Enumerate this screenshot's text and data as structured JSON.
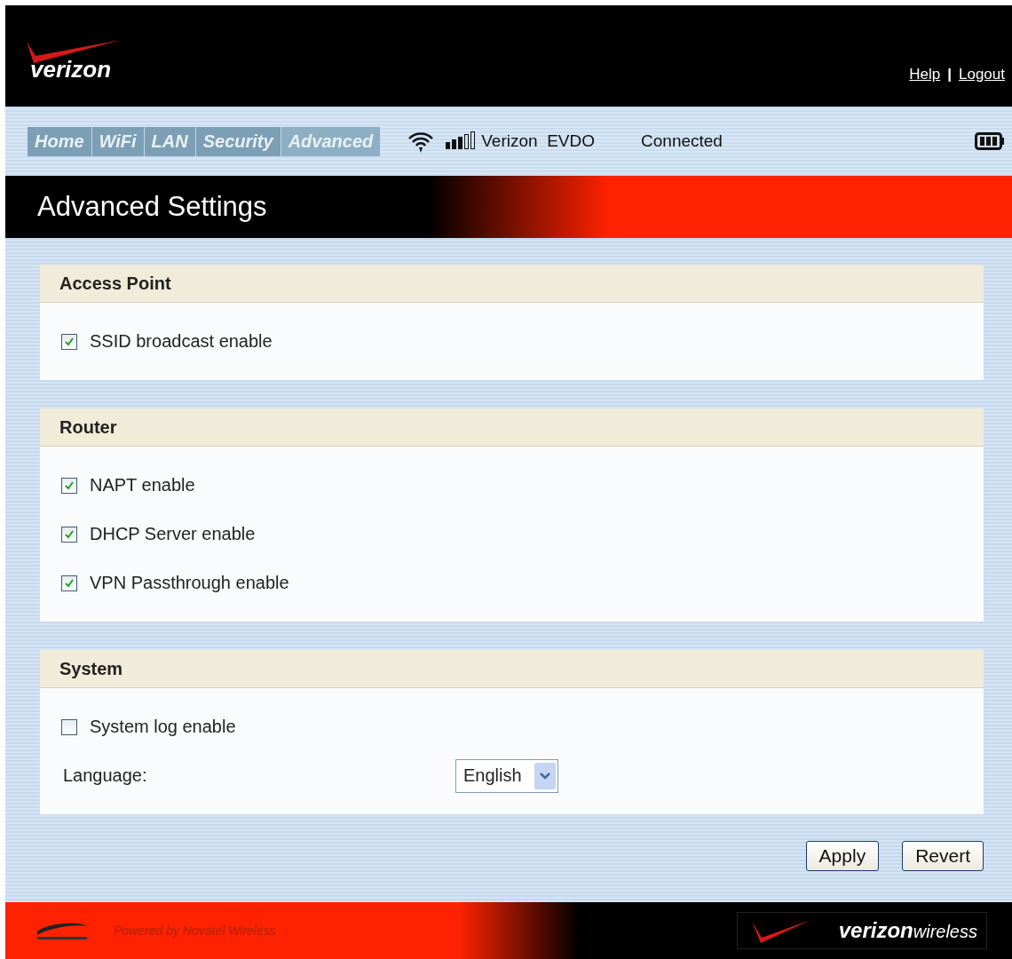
{
  "header": {
    "logo": "verizon",
    "links": [
      "Help",
      "Logout"
    ],
    "separator": "|"
  },
  "nav": {
    "tabs": [
      {
        "label": "Home",
        "selected": false
      },
      {
        "label": "WiFi",
        "selected": false
      },
      {
        "label": "LAN",
        "selected": false
      },
      {
        "label": "Security",
        "selected": false
      },
      {
        "label": "Advanced",
        "selected": true
      }
    ],
    "network": "Verizon  EVDO",
    "status": "Connected"
  },
  "page_title": "Advanced Settings",
  "sections": [
    {
      "title": "Access Point",
      "rows": [
        {
          "kind": "checkbox",
          "label": "SSID broadcast enable",
          "checked": true
        }
      ]
    },
    {
      "title": "Router",
      "rows": [
        {
          "kind": "checkbox",
          "label": "NAPT enable",
          "checked": true
        },
        {
          "kind": "checkbox",
          "label": "DHCP Server enable",
          "checked": true
        },
        {
          "kind": "checkbox",
          "label": "VPN Passthrough enable",
          "checked": true
        }
      ]
    },
    {
      "title": "System",
      "rows": [
        {
          "kind": "checkbox",
          "label": "System log enable",
          "checked": false
        },
        {
          "kind": "select",
          "label": "Language:",
          "value": "English"
        }
      ]
    }
  ],
  "buttons": [
    "Apply",
    "Revert"
  ],
  "footer": {
    "powered_by": "Powered by Novatel Wireless",
    "logo": "**verizon**wireless"
  }
}
